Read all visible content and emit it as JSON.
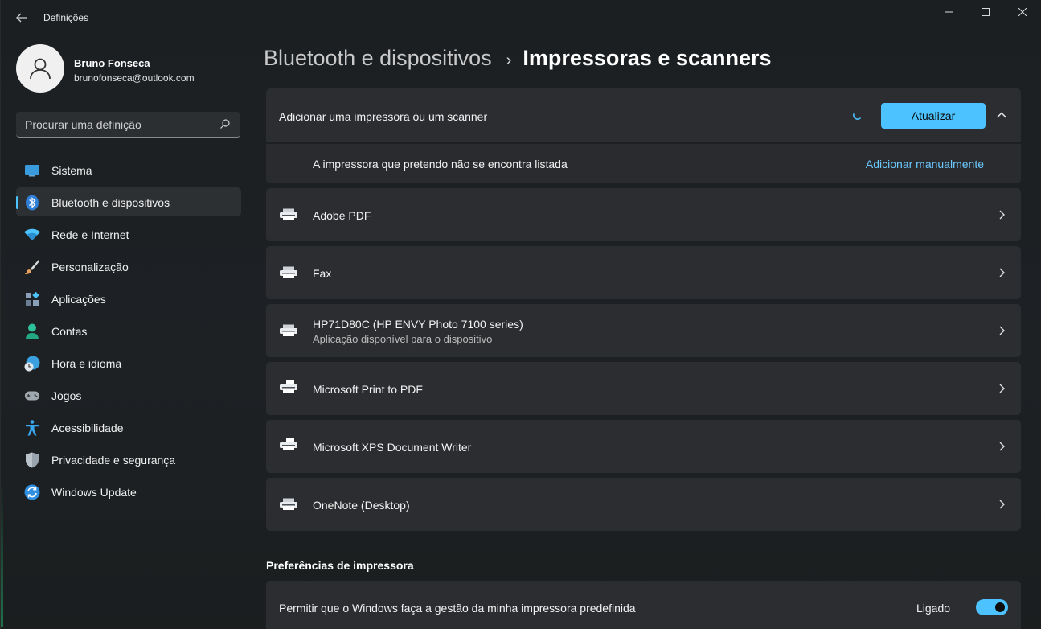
{
  "window": {
    "title": "Definições",
    "back_icon": "arrow-left-icon",
    "controls": [
      "minimize-icon",
      "maximize-icon",
      "close-icon"
    ]
  },
  "profile": {
    "name": "Bruno Fonseca",
    "email": "brunofonseca@outlook.com"
  },
  "search": {
    "placeholder": "Procurar uma definição"
  },
  "sidebar": {
    "items": [
      {
        "label": "Sistema",
        "icon": "monitor-icon",
        "color": "#3a9bdc"
      },
      {
        "label": "Bluetooth e dispositivos",
        "icon": "bluetooth-icon",
        "color": "#2f7fd6",
        "active": true
      },
      {
        "label": "Rede e Internet",
        "icon": "wifi-icon",
        "color": "#4cc2ff"
      },
      {
        "label": "Personalização",
        "icon": "brush-icon",
        "color": "#e8a060"
      },
      {
        "label": "Aplicações",
        "icon": "apps-icon",
        "color": "#8aa0b8"
      },
      {
        "label": "Contas",
        "icon": "person-icon",
        "color": "#2ec29a"
      },
      {
        "label": "Hora e idioma",
        "icon": "globe-clock-icon",
        "color": "#3aa0e0"
      },
      {
        "label": "Jogos",
        "icon": "gamepad-icon",
        "color": "#a0a8b0"
      },
      {
        "label": "Acessibilidade",
        "icon": "accessibility-icon",
        "color": "#3aa8f0"
      },
      {
        "label": "Privacidade e segurança",
        "icon": "shield-icon",
        "color": "#9aa4ae"
      },
      {
        "label": "Windows Update",
        "icon": "update-icon",
        "color": "#2f8fe0"
      }
    ]
  },
  "breadcrumb": {
    "parent": "Bluetooth e dispositivos",
    "separator": "›",
    "current": "Impressoras e scanners"
  },
  "add_printer": {
    "label": "Adicionar uma impressora ou um scanner",
    "update_button": "Atualizar",
    "not_listed": "A impressora que pretendo não se encontra listada",
    "manual_link": "Adicionar manualmente"
  },
  "printers": [
    {
      "name": "Adobe PDF",
      "sub": ""
    },
    {
      "name": "Fax",
      "sub": ""
    },
    {
      "name": "HP71D80C (HP ENVY Photo 7100 series)",
      "sub": "Aplicação disponível para o dispositivo"
    },
    {
      "name": "Microsoft Print to PDF",
      "sub": ""
    },
    {
      "name": "Microsoft XPS Document Writer",
      "sub": ""
    },
    {
      "name": "OneNote (Desktop)",
      "sub": ""
    }
  ],
  "preferences": {
    "title": "Preferências de impressora",
    "default_manage_label": "Permitir que o Windows faça a gestão da minha impressora predefinida",
    "toggle_state": "Ligado",
    "toggle_on": true
  },
  "colors": {
    "accent": "#4cc2ff",
    "card": "#2b2d30",
    "background": "#1c1f22"
  }
}
